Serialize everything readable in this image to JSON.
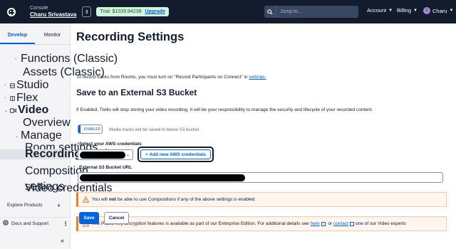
{
  "topbar": {
    "console_label": "Console",
    "account_name": "Charu Srivastava",
    "switch_icon": "chevron-updown-icon",
    "trial_text": "Trial: $1039.84238",
    "upgrade_label": "Upgrade",
    "search_placeholder": "Jump to...",
    "account_menu": "Account",
    "billing_menu": "Billing",
    "user_initials": "C",
    "user_name": "Charu"
  },
  "sidebar": {
    "tabs": [
      {
        "label": "Develop",
        "active": true
      },
      {
        "label": "Monitor",
        "active": false
      }
    ],
    "items": [
      {
        "label": "Functions (Classic)"
      },
      {
        "label": "Assets (Classic)"
      },
      {
        "label": "Studio"
      },
      {
        "label": "Flex"
      },
      {
        "label": "Video"
      },
      {
        "label": "Overview"
      },
      {
        "label": "Manage"
      },
      {
        "label": "Room settings"
      },
      {
        "label": "Recording settings"
      },
      {
        "label": "Composition settings"
      },
      {
        "label": "Video credentials"
      }
    ],
    "explore_label": "Explore Products",
    "docs_label": "Docs and Support",
    "collapse_symbol": "«"
  },
  "main": {
    "title": "Recording Settings",
    "intro_text": "To record tracks from Rooms, you must turn on \"Record Participants on Connect\" in ",
    "intro_link": "settings.",
    "section_title": "Save to an External S3 Bucket",
    "section_desc": "If Enabled, Twilio will stop storing your video recording. It will be your responsibility to manage the security and lifecycle of your recorded content.",
    "toggle_label": "ENABLED",
    "toggle_note": "Media tracks will be saved to below S3 bucket.",
    "credentials_label": "Select your AWS credentials",
    "add_credentials_label": "+ Add new AWS credentials",
    "bucket_label": "External S3 Bucket URL",
    "alert1": {
      "pre": "You will ",
      "bold": "not",
      "post": " be able to use Compositions if any of the above settings is enabled"
    },
    "alert2": {
      "text": "The Public Key Encryption features is available as part of our Enterprise Edition. For additional details see ",
      "link1": "here",
      "or": " or ",
      "link2": "contact",
      "post": " one of our Video experts"
    },
    "save_label": "Save",
    "cancel_label": "Cancel"
  },
  "colors": {
    "topbar_bg": "#121c2d",
    "accent": "#0263e0",
    "warning": "#f47c22",
    "sidebar_bg": "#f4f4f6"
  }
}
